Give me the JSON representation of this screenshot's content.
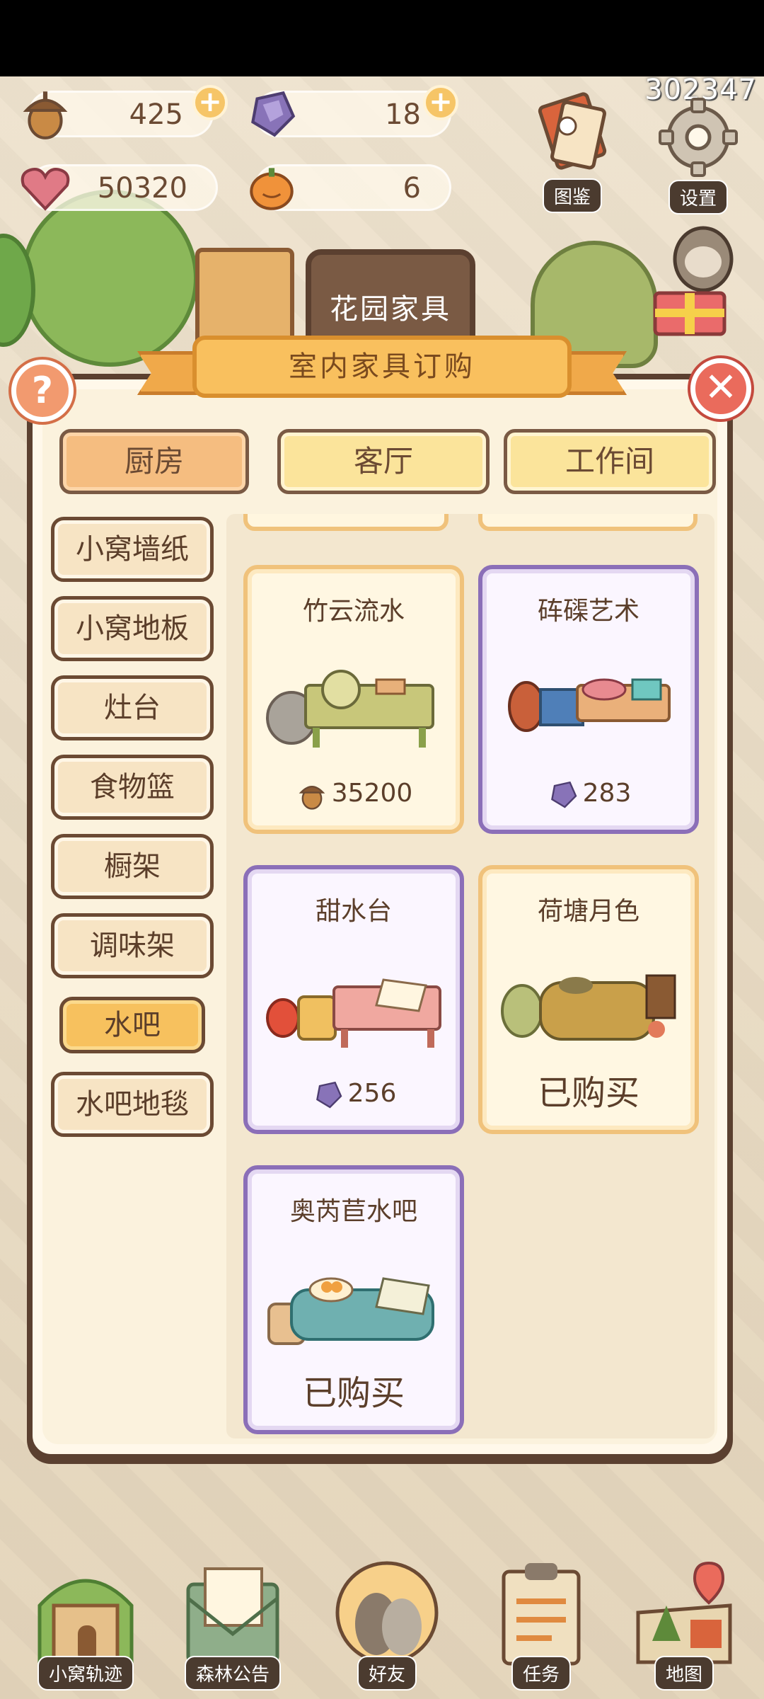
{
  "top_id": "302347",
  "currencies": [
    {
      "name": "acorn",
      "value": "425",
      "has_plus": true
    },
    {
      "name": "gem",
      "value": "18",
      "has_plus": true
    },
    {
      "name": "heart",
      "value": "50320",
      "has_plus": false
    },
    {
      "name": "pumpkin",
      "value": "6",
      "has_plus": false
    }
  ],
  "corner_buttons": {
    "catalog": "图鉴",
    "settings": "设置"
  },
  "sign_text": "花园家具",
  "panel": {
    "title": "室内家具订购",
    "help": "?",
    "close": "✕"
  },
  "tabs": [
    {
      "label": "厨房",
      "active": true
    },
    {
      "label": "客厅",
      "active": false
    },
    {
      "label": "工作间",
      "active": false
    }
  ],
  "categories": [
    {
      "label": "小窝墙纸",
      "active": false
    },
    {
      "label": "小窝地板",
      "active": false
    },
    {
      "label": "灶台",
      "active": false
    },
    {
      "label": "食物篮",
      "active": false
    },
    {
      "label": "橱架",
      "active": false
    },
    {
      "label": "调味架",
      "active": false
    },
    {
      "label": "水吧",
      "active": true
    },
    {
      "label": "水吧地毯",
      "active": false
    }
  ],
  "items": [
    {
      "name": "竹云流水",
      "style": "gold",
      "currency": "acorn",
      "price": "35200",
      "status": ""
    },
    {
      "name": "砗磲艺术",
      "style": "purple",
      "currency": "gem",
      "price": "283",
      "status": ""
    },
    {
      "name": "甜水台",
      "style": "purple",
      "currency": "gem",
      "price": "256",
      "status": ""
    },
    {
      "name": "荷塘月色",
      "style": "gold",
      "currency": "",
      "price": "",
      "status": "已购买"
    },
    {
      "name": "奥芮苣水吧",
      "style": "purple",
      "currency": "",
      "price": "",
      "status": "已购买"
    }
  ],
  "bottom_nav": [
    {
      "label": "小窝轨迹",
      "icon": "house-icon"
    },
    {
      "label": "森林公告",
      "icon": "letter-icon"
    },
    {
      "label": "好友",
      "icon": "friends-icon"
    },
    {
      "label": "任务",
      "icon": "clipboard-icon"
    },
    {
      "label": "地图",
      "icon": "map-icon"
    }
  ]
}
